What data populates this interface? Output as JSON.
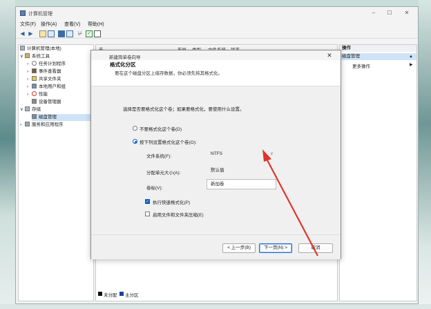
{
  "window": {
    "title": "计算机管理",
    "controls": {
      "minimize": "–",
      "maximize": "☐",
      "close": "✕"
    }
  },
  "menu": [
    "文件(F)",
    "操作(A)",
    "查看(V)",
    "帮助(H)"
  ],
  "tree": {
    "items": [
      {
        "label": "计算机管理(本地)",
        "indent": 0,
        "arrow": ""
      },
      {
        "label": "系统工具",
        "indent": 1,
        "arrow": "∨"
      },
      {
        "label": "任务计划程序",
        "indent": 2,
        "arrow": "›"
      },
      {
        "label": "事件查看器",
        "indent": 2,
        "arrow": "›"
      },
      {
        "label": "共享文件夹",
        "indent": 2,
        "arrow": "›"
      },
      {
        "label": "本地用户和组",
        "indent": 2,
        "arrow": "›"
      },
      {
        "label": "性能",
        "indent": 2,
        "arrow": "›"
      },
      {
        "label": "设备管理器",
        "indent": 2,
        "arrow": ""
      },
      {
        "label": "存储",
        "indent": 1,
        "arrow": "∨"
      },
      {
        "label": "磁盘管理",
        "indent": 2,
        "arrow": ""
      },
      {
        "label": "服务和应用程序",
        "indent": 1,
        "arrow": "›"
      }
    ]
  },
  "volume_table": {
    "columns": [
      "卷",
      "布局",
      "类型",
      "文件系统",
      "状态"
    ],
    "fragments": [
      "基",
      "59",
      "联",
      "DV",
      "4.",
      "联"
    ]
  },
  "legend": {
    "unallocated": "未分配",
    "primary": "主分区"
  },
  "actions": {
    "header": "操作",
    "selected": "磁盘管理",
    "more": "更多操作",
    "arrow_up": "▲",
    "arrow_right": "▶"
  },
  "wizard": {
    "title": "新建简单卷向导",
    "close": "✕",
    "heading": "格式化分区",
    "subheading": "要在这个磁盘分区上储存数据，你必须先将其格式化。",
    "prompt": "选择是否要格式化这个卷；如果要格式化，要使用什么设置。",
    "option_no_format": "不要格式化这个卷(D)",
    "option_format": "按下列设置格式化这个卷(O):",
    "fs_label": "文件系统(F):",
    "fs_value": "NTFS",
    "fs_arrow": "∨",
    "alloc_label": "分配单元大小(A):",
    "alloc_value": "默认值",
    "volume_label": "卷标(V):",
    "volume_value": "新加卷",
    "quick_format": "执行快速格式化(P)",
    "quick_format_checked": true,
    "compress": "启用文件和文件夹压缩(E)",
    "compress_checked": false,
    "back": "< 上一步(B)",
    "next": "下一页(N) >",
    "cancel": "取消"
  },
  "annotation_color": "#e0352b"
}
